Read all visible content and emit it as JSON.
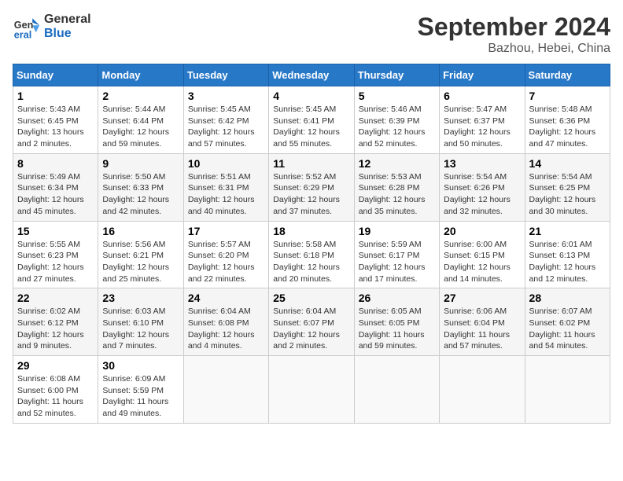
{
  "header": {
    "logo_line1": "General",
    "logo_line2": "Blue",
    "month": "September 2024",
    "location": "Bazhou, Hebei, China"
  },
  "weekdays": [
    "Sunday",
    "Monday",
    "Tuesday",
    "Wednesday",
    "Thursday",
    "Friday",
    "Saturday"
  ],
  "weeks": [
    [
      {
        "day": "1",
        "info": "Sunrise: 5:43 AM\nSunset: 6:45 PM\nDaylight: 13 hours\nand 2 minutes."
      },
      {
        "day": "2",
        "info": "Sunrise: 5:44 AM\nSunset: 6:44 PM\nDaylight: 12 hours\nand 59 minutes."
      },
      {
        "day": "3",
        "info": "Sunrise: 5:45 AM\nSunset: 6:42 PM\nDaylight: 12 hours\nand 57 minutes."
      },
      {
        "day": "4",
        "info": "Sunrise: 5:45 AM\nSunset: 6:41 PM\nDaylight: 12 hours\nand 55 minutes."
      },
      {
        "day": "5",
        "info": "Sunrise: 5:46 AM\nSunset: 6:39 PM\nDaylight: 12 hours\nand 52 minutes."
      },
      {
        "day": "6",
        "info": "Sunrise: 5:47 AM\nSunset: 6:37 PM\nDaylight: 12 hours\nand 50 minutes."
      },
      {
        "day": "7",
        "info": "Sunrise: 5:48 AM\nSunset: 6:36 PM\nDaylight: 12 hours\nand 47 minutes."
      }
    ],
    [
      {
        "day": "8",
        "info": "Sunrise: 5:49 AM\nSunset: 6:34 PM\nDaylight: 12 hours\nand 45 minutes."
      },
      {
        "day": "9",
        "info": "Sunrise: 5:50 AM\nSunset: 6:33 PM\nDaylight: 12 hours\nand 42 minutes."
      },
      {
        "day": "10",
        "info": "Sunrise: 5:51 AM\nSunset: 6:31 PM\nDaylight: 12 hours\nand 40 minutes."
      },
      {
        "day": "11",
        "info": "Sunrise: 5:52 AM\nSunset: 6:29 PM\nDaylight: 12 hours\nand 37 minutes."
      },
      {
        "day": "12",
        "info": "Sunrise: 5:53 AM\nSunset: 6:28 PM\nDaylight: 12 hours\nand 35 minutes."
      },
      {
        "day": "13",
        "info": "Sunrise: 5:54 AM\nSunset: 6:26 PM\nDaylight: 12 hours\nand 32 minutes."
      },
      {
        "day": "14",
        "info": "Sunrise: 5:54 AM\nSunset: 6:25 PM\nDaylight: 12 hours\nand 30 minutes."
      }
    ],
    [
      {
        "day": "15",
        "info": "Sunrise: 5:55 AM\nSunset: 6:23 PM\nDaylight: 12 hours\nand 27 minutes."
      },
      {
        "day": "16",
        "info": "Sunrise: 5:56 AM\nSunset: 6:21 PM\nDaylight: 12 hours\nand 25 minutes."
      },
      {
        "day": "17",
        "info": "Sunrise: 5:57 AM\nSunset: 6:20 PM\nDaylight: 12 hours\nand 22 minutes."
      },
      {
        "day": "18",
        "info": "Sunrise: 5:58 AM\nSunset: 6:18 PM\nDaylight: 12 hours\nand 20 minutes."
      },
      {
        "day": "19",
        "info": "Sunrise: 5:59 AM\nSunset: 6:17 PM\nDaylight: 12 hours\nand 17 minutes."
      },
      {
        "day": "20",
        "info": "Sunrise: 6:00 AM\nSunset: 6:15 PM\nDaylight: 12 hours\nand 14 minutes."
      },
      {
        "day": "21",
        "info": "Sunrise: 6:01 AM\nSunset: 6:13 PM\nDaylight: 12 hours\nand 12 minutes."
      }
    ],
    [
      {
        "day": "22",
        "info": "Sunrise: 6:02 AM\nSunset: 6:12 PM\nDaylight: 12 hours\nand 9 minutes."
      },
      {
        "day": "23",
        "info": "Sunrise: 6:03 AM\nSunset: 6:10 PM\nDaylight: 12 hours\nand 7 minutes."
      },
      {
        "day": "24",
        "info": "Sunrise: 6:04 AM\nSunset: 6:08 PM\nDaylight: 12 hours\nand 4 minutes."
      },
      {
        "day": "25",
        "info": "Sunrise: 6:04 AM\nSunset: 6:07 PM\nDaylight: 12 hours\nand 2 minutes."
      },
      {
        "day": "26",
        "info": "Sunrise: 6:05 AM\nSunset: 6:05 PM\nDaylight: 11 hours\nand 59 minutes."
      },
      {
        "day": "27",
        "info": "Sunrise: 6:06 AM\nSunset: 6:04 PM\nDaylight: 11 hours\nand 57 minutes."
      },
      {
        "day": "28",
        "info": "Sunrise: 6:07 AM\nSunset: 6:02 PM\nDaylight: 11 hours\nand 54 minutes."
      }
    ],
    [
      {
        "day": "29",
        "info": "Sunrise: 6:08 AM\nSunset: 6:00 PM\nDaylight: 11 hours\nand 52 minutes."
      },
      {
        "day": "30",
        "info": "Sunrise: 6:09 AM\nSunset: 5:59 PM\nDaylight: 11 hours\nand 49 minutes."
      },
      {
        "day": "",
        "info": ""
      },
      {
        "day": "",
        "info": ""
      },
      {
        "day": "",
        "info": ""
      },
      {
        "day": "",
        "info": ""
      },
      {
        "day": "",
        "info": ""
      }
    ]
  ]
}
